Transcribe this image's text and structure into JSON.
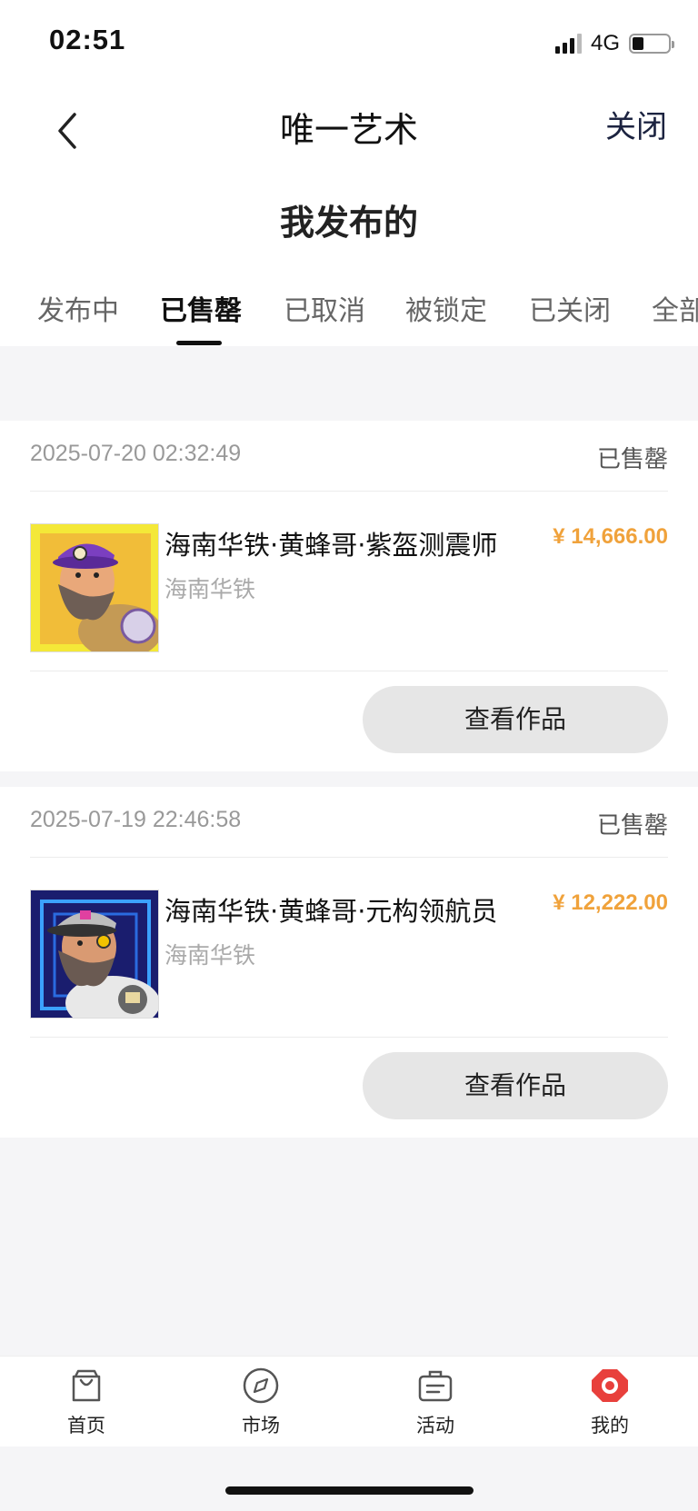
{
  "status_bar": {
    "time": "02:51",
    "network": "4G"
  },
  "nav": {
    "title": "唯一艺术",
    "close_label": "关闭",
    "page_title": "我发布的"
  },
  "tabs": [
    {
      "label": "发布中",
      "active": false
    },
    {
      "label": "已售罄",
      "active": true
    },
    {
      "label": "已取消",
      "active": false
    },
    {
      "label": "被锁定",
      "active": false
    },
    {
      "label": "已关闭",
      "active": false
    },
    {
      "label": "全部",
      "active": false
    }
  ],
  "orders": [
    {
      "time": "2025-07-20 02:32:49",
      "status": "已售罄",
      "name": "海南华铁·黄蜂哥·紫盔测震师",
      "brand": "海南华铁",
      "price": "¥ 14,666.00",
      "button": "查看作品"
    },
    {
      "time": "2025-07-19 22:46:58",
      "status": "已售罄",
      "name": "海南华铁·黄蜂哥·元构领航员",
      "brand": "海南华铁",
      "price": "¥ 12,222.00",
      "button": "查看作品"
    }
  ],
  "bottom_nav": [
    {
      "label": "首页",
      "icon": "bag-icon"
    },
    {
      "label": "市场",
      "icon": "compass-icon"
    },
    {
      "label": "活动",
      "icon": "briefcase-icon"
    },
    {
      "label": "我的",
      "icon": "profile-hexagon-icon",
      "active": true
    }
  ],
  "colors": {
    "price": "#f0a23b",
    "active_tab": "#111111",
    "active_nav": "#e8403c"
  }
}
